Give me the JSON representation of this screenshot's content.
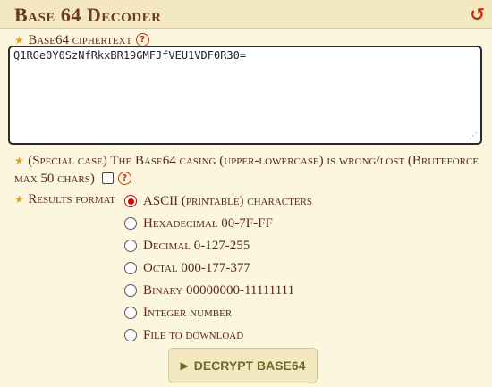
{
  "header": {
    "title": "Base 64 Decoder",
    "reset_icon": "undo-arrow-icon"
  },
  "cipher": {
    "label": "Base64 ciphertext",
    "value": "Q1RGe0Y0SzNfRkxBR19GMFJfVEU1VDF0R30=",
    "help": "?"
  },
  "special": {
    "label": "(Special case) The Base64 casing (upper-lowercase) is wrong/lost (Bruteforce max 50 chars)",
    "checked": false,
    "help": "?"
  },
  "results_format": {
    "label": "Results format",
    "options": [
      {
        "label": "ASCII (printable) characters",
        "selected": true
      },
      {
        "label": "Hexadecimal 00-7F-FF",
        "selected": false
      },
      {
        "label": "Decimal 0-127-255",
        "selected": false
      },
      {
        "label": "Octal 000-177-377",
        "selected": false
      },
      {
        "label": "Binary 00000000-11111111",
        "selected": false
      },
      {
        "label": "Integer number",
        "selected": false
      },
      {
        "label": "File to download",
        "selected": false
      }
    ]
  },
  "submit": {
    "label": "DECRYPT BASE64",
    "icon": "play-icon"
  },
  "colors": {
    "background": "#fdf6df",
    "header": "#f4e8c1",
    "text": "#5a2a14",
    "accent": "#c4320a",
    "button_text": "#6b6b2a"
  }
}
